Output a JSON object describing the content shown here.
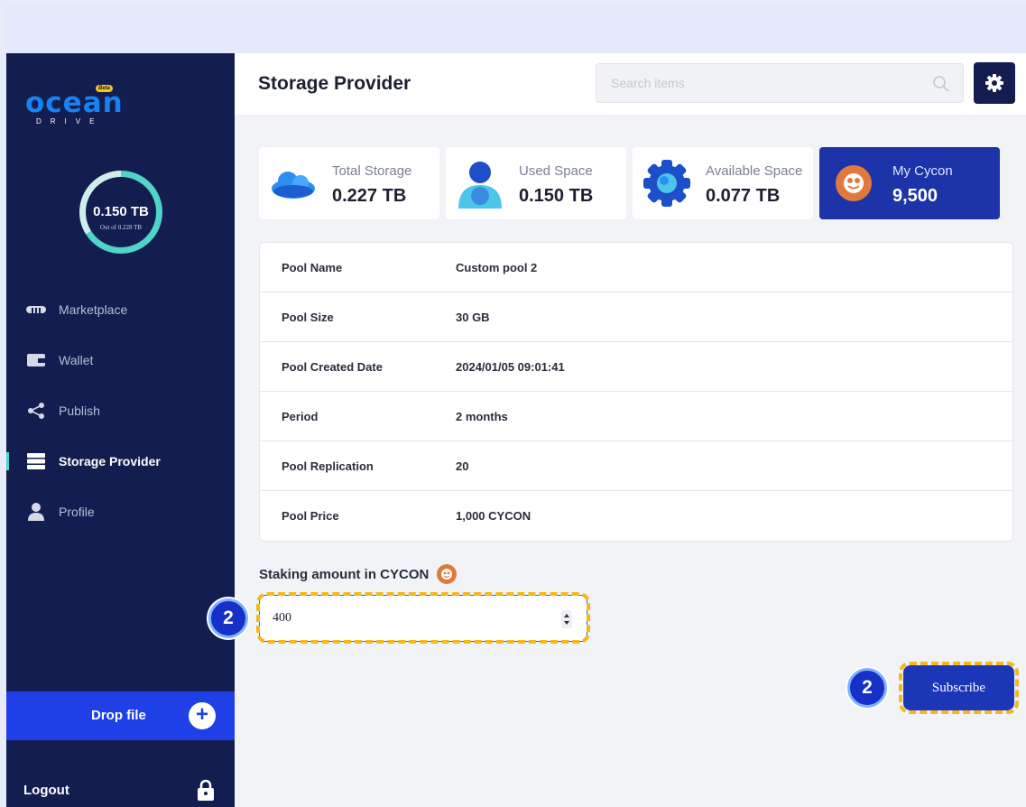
{
  "app": {
    "logo_text": "ocean",
    "logo_sub": "DRIVE",
    "logo_badge": "Beta"
  },
  "storage_ring": {
    "value": "0.150 TB",
    "sub": "Out of 0.228 TB",
    "fill_fraction": 0.66
  },
  "sidebar": {
    "items": [
      {
        "label": "Marketplace",
        "icon": "marketplace-icon"
      },
      {
        "label": "Wallet",
        "icon": "wallet-icon"
      },
      {
        "label": "Publish",
        "icon": "share-icon"
      },
      {
        "label": "Storage Provider",
        "icon": "server-icon",
        "active": true
      },
      {
        "label": "Profile",
        "icon": "user-icon"
      }
    ],
    "drop_file": "Drop file",
    "logout": "Logout"
  },
  "header": {
    "title": "Storage Provider",
    "search_placeholder": "Search items"
  },
  "cards": [
    {
      "title": "Total Storage",
      "value": "0.227 TB",
      "icon": "cloud-icon"
    },
    {
      "title": "Used Space",
      "value": "0.150 TB",
      "icon": "user-globe-icon"
    },
    {
      "title": "Available Space",
      "value": "0.077 TB",
      "icon": "gear-globe-icon"
    },
    {
      "title": "My Cycon",
      "value": "9,500",
      "icon": "cycon-coin-icon"
    }
  ],
  "pool": [
    {
      "key": "Pool Name",
      "value": "Custom pool 2"
    },
    {
      "key": "Pool Size",
      "value": "30 GB"
    },
    {
      "key": "Pool Created Date",
      "value": "2024/01/05 09:01:41"
    },
    {
      "key": "Period",
      "value": "2 months"
    },
    {
      "key": "Pool Replication",
      "value": "20"
    },
    {
      "key": "Pool Price",
      "value": "1,000 CYCON"
    }
  ],
  "staking": {
    "label": "Staking amount in CYCON",
    "value": "400"
  },
  "subscribe_label": "Subscribe",
  "step_badges": {
    "input": "2",
    "subscribe": "2"
  },
  "colors": {
    "sidebar_bg": "#141d4f",
    "accent_blue": "#1e40e6",
    "ring_teal": "#4fd4c9",
    "highlight_yellow": "#f4b81c"
  }
}
